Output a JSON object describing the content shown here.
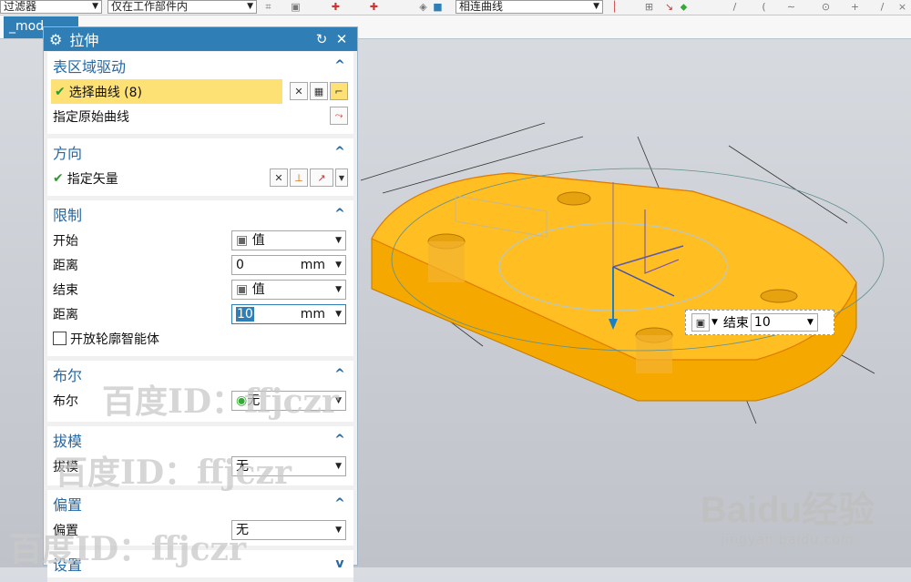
{
  "toolbar": {
    "filter_label": "过滤器",
    "scope_label": "仅在工作部件内",
    "curve_rule_label": "相连曲线"
  },
  "model_tab": {
    "label": "_mod"
  },
  "dialog": {
    "title": "拉伸",
    "sections": {
      "section_drive": {
        "title": "表区域驱动",
        "select_curve": "选择曲线 (8)",
        "orig_curve": "指定原始曲线"
      },
      "direction": {
        "title": "方向",
        "vector": "指定矢量"
      },
      "limits": {
        "title": "限制",
        "start_label": "开始",
        "start_value": "值",
        "dist1_label": "距离",
        "dist1_value": "0",
        "dist1_unit": "mm",
        "end_label": "结束",
        "end_value": "值",
        "dist2_label": "距离",
        "dist2_value": "10",
        "dist2_unit": "mm",
        "open_profile": "开放轮廓智能体"
      },
      "boolean": {
        "title": "布尔",
        "label": "布尔",
        "value": "无"
      },
      "draft": {
        "title": "拔模",
        "label": "拔模",
        "value": "无"
      },
      "offset": {
        "title": "偏置",
        "label": "偏置",
        "value": "无"
      },
      "settings": {
        "title": "设置"
      }
    }
  },
  "onscreen_input": {
    "label": "结束",
    "value": "10"
  },
  "watermarks": {
    "baidu_id": "百度ID：ffjczr",
    "baidu_logo": "Baidu经验",
    "baidu_url": "jingyan.baidu.com"
  },
  "colors": {
    "accent": "#2f7fb6",
    "model": "#f5a800",
    "highlight": "#fde174"
  }
}
